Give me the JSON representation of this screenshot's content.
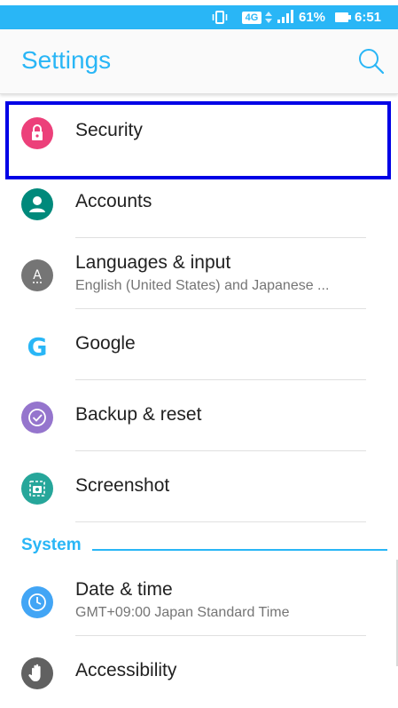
{
  "status_bar": {
    "network": "4G",
    "battery_percent": "61%",
    "time": "6:51 PM"
  },
  "app_bar": {
    "title": "Settings"
  },
  "items": [
    {
      "label": "Security",
      "icon": "lock-icon",
      "color": "#ec407a"
    },
    {
      "label": "Accounts",
      "icon": "person-icon",
      "color": "#00897b"
    },
    {
      "label": "Languages & input",
      "subtitle": "English (United States) and Japanese ...",
      "icon": "language-icon",
      "color": "#757575"
    },
    {
      "label": "Google",
      "icon": "google-icon",
      "color": "#29b6f6"
    },
    {
      "label": "Backup & reset",
      "icon": "backup-icon",
      "color": "#9575cd"
    },
    {
      "label": "Screenshot",
      "icon": "screenshot-icon",
      "color": "#26a69a"
    }
  ],
  "section": {
    "title": "System"
  },
  "system_items": [
    {
      "label": "Date & time",
      "subtitle": "GMT+09:00 Japan Standard Time",
      "icon": "clock-icon",
      "color": "#42a5f5"
    },
    {
      "label": "Accessibility",
      "icon": "hand-icon",
      "color": "#616161"
    }
  ],
  "colors": {
    "accent": "#29b6f6",
    "highlight": "#0000e6"
  }
}
